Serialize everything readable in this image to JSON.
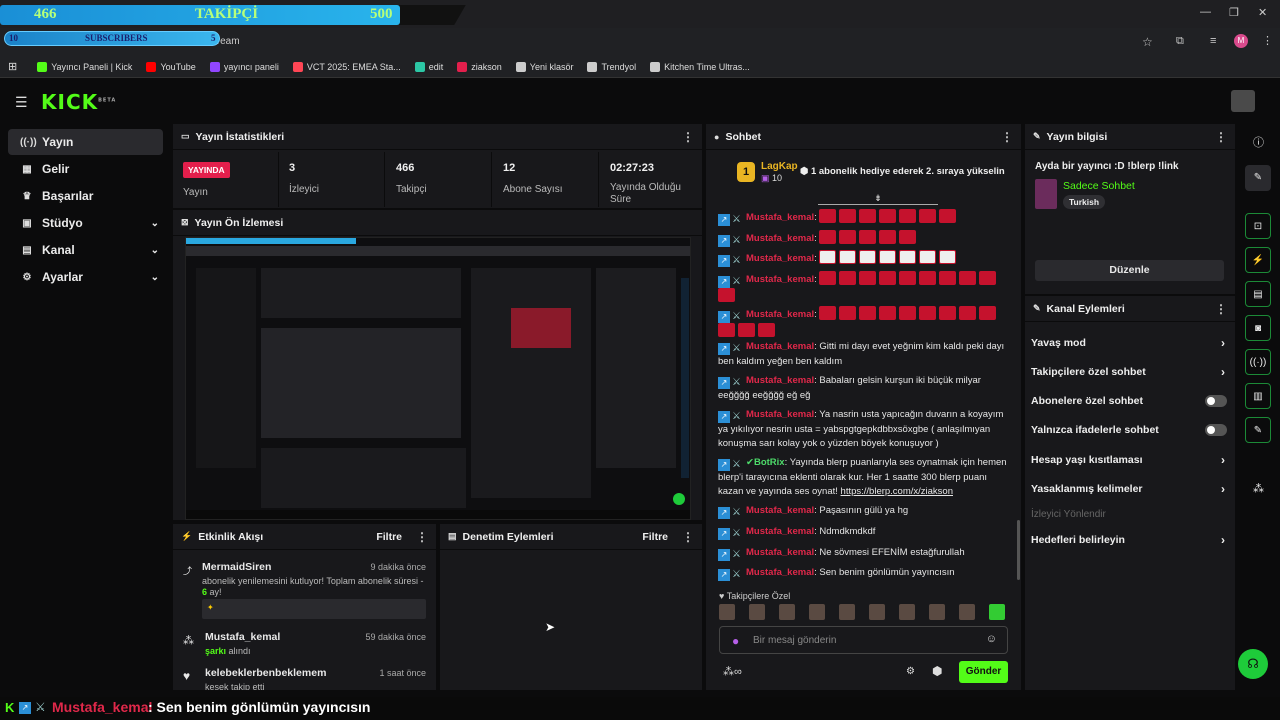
{
  "browser": {
    "address_partial": "tream",
    "bookmarks": [
      {
        "label": "Yayıncı Paneli | Kick",
        "color": "#53fc18"
      },
      {
        "label": "YouTube",
        "color": "#ff0000"
      },
      {
        "label": "yayıncı paneli",
        "color": "#9146ff"
      },
      {
        "label": "VCT 2025: EMEA Sta...",
        "color": "#ff4655"
      },
      {
        "label": "edit",
        "color": "#2cc7a5"
      },
      {
        "label": "ziakson",
        "color": "#e31f4c"
      },
      {
        "label": "Yeni klasör",
        "color": "#cccccc"
      },
      {
        "label": "Trendyol",
        "color": "#cccccc"
      },
      {
        "label": "Kitchen Time Ultras...",
        "color": "#cccccc"
      }
    ],
    "profile_initial": "M"
  },
  "overlay": {
    "followers_current": "466",
    "followers_label": "TAKİPÇİ",
    "followers_goal": "500",
    "subs_current": "10",
    "subs_label": "SUBSCRIBERS",
    "subs_goal": "5"
  },
  "app": {
    "logo": "KICK",
    "logo_badge": "BETA",
    "nav": [
      {
        "label": "Yayın",
        "icon": "broadcast-icon"
      },
      {
        "label": "Gelir",
        "icon": "revenue-icon"
      },
      {
        "label": "Başarılar",
        "icon": "trophy-icon"
      },
      {
        "label": "Stüdyo",
        "icon": "studio-icon"
      },
      {
        "label": "Kanal",
        "icon": "channel-icon"
      },
      {
        "label": "Ayarlar",
        "icon": "settings-icon"
      }
    ]
  },
  "stats": {
    "title": "Yayın İstatistikleri",
    "live_badge": "YAYINDA",
    "items": [
      {
        "value": "",
        "label": "Yayın"
      },
      {
        "value": "3",
        "label": "İzleyici"
      },
      {
        "value": "466",
        "label": "Takipçi"
      },
      {
        "value": "12",
        "label": "Abone Sayısı"
      },
      {
        "value": "02:27:23",
        "label": "Yayında Olduğu Süre"
      }
    ]
  },
  "preview": {
    "title": "Yayın Ön İzlemesi"
  },
  "activity": {
    "title": "Etkinlik Akışı",
    "filter": "Filtre",
    "events": [
      {
        "user": "MermaidSiren",
        "time": "9 dakika önce",
        "text": "abonelik yenilemesini kutluyor! Toplam abonelik süresi - ",
        "highlight": "6",
        "text2": " ay!"
      },
      {
        "user": "Mustafa_kemal",
        "time": "59 dakika önce",
        "highlight": "şarkı",
        "text": " alındı"
      },
      {
        "user": "kelebeklerbenbeklemem",
        "time": "1 saat önce",
        "text": "kesek takip etti"
      }
    ]
  },
  "moderation": {
    "title": "Denetim Eylemleri",
    "filter": "Filtre"
  },
  "chat": {
    "title": "Sohbet",
    "leader": {
      "name": "LagKap",
      "rank": "1",
      "count": "10",
      "message": "1 abonelik hediye ederek 2. sıraya yükselin"
    },
    "messages": [
      {
        "user": "Mustafa_kemal",
        "text": ""
      },
      {
        "user": "Mustafa_kemal",
        "text": ""
      },
      {
        "user": "Mustafa_kemal",
        "text": ""
      },
      {
        "user": "Mustafa_kemal",
        "text": ""
      },
      {
        "user": "Mustafa_kemal",
        "text": ""
      },
      {
        "user": "Mustafa_kemal",
        "text": "Gitti mi dayı evet yeğnim kim kaldı peki dayı ben kaldım yeğen ben kaldım"
      },
      {
        "user": "Mustafa_kemal",
        "text": "Babaları gelsin kurşun iki büçük milyar eeğğğğ eeğğğğ eğ eğ"
      },
      {
        "user": "Mustafa_kemal",
        "text": "Ya nasrin usta yapıcağın duvarın a koyayım ya yıkılıyor nesrin usta = yabspgtgepkdbbxsöxgbe ( anlaşılmıyan konuşma sarı kolay yok o yüzden böyek konuşuyor )"
      },
      {
        "user": "BotRix",
        "text": "Yayında blerp puanlarıyla ses oynatmak için hemen blerp'i tarayıcına eklenti olarak kur. Her 1 saatte 300 blerp puanı kazan ve yayında ses oynat! ",
        "link": "https://blerp.com/x/ziakson"
      },
      {
        "user": "Mustafa_kemal",
        "text": "Paşasının gülü ya hg"
      },
      {
        "user": "Mustafa_kemal",
        "text": "Ndmdkmdkdf"
      },
      {
        "user": "Mustafa_kemal",
        "text": "Ne sövmesi EFENİM estağfurullah"
      },
      {
        "user": "Mustafa_kemal",
        "text": "Sen benim gönlümün yayıncısın"
      }
    ],
    "followers_only_label": "Takipçilere Özel",
    "input_placeholder": "Bir mesaj gönderin",
    "send_label": "Gönder"
  },
  "stream_info": {
    "title": "Yayın bilgisi",
    "stream_title": "Ayda bir yayıncı :D !blerp !link",
    "category": "Sadece Sohbet",
    "language": "Turkish",
    "edit_label": "Düzenle"
  },
  "channel_actions": {
    "title": "Kanal Eylemleri",
    "items": [
      {
        "label": "Yavaş mod",
        "kind": "chevron"
      },
      {
        "label": "Takipçilere özel sohbet",
        "kind": "chevron"
      },
      {
        "label": "Abonelere özel sohbet",
        "kind": "toggle"
      },
      {
        "label": "Yalnızca ifadelerle sohbet",
        "kind": "toggle"
      },
      {
        "label": "Hesap yaşı kısıtlaması",
        "kind": "chevron"
      },
      {
        "label": "Yasaklanmış kelimeler",
        "kind": "chevron"
      },
      {
        "label": "İzleyici Yönlendir",
        "kind": "disabled"
      },
      {
        "label": "Hedefleri belirleyin",
        "kind": "chevron"
      }
    ]
  },
  "bottom_overlay": {
    "user": "Mustafa_kemal",
    "text": ": Sen benim gönlümün yayıncısın"
  }
}
